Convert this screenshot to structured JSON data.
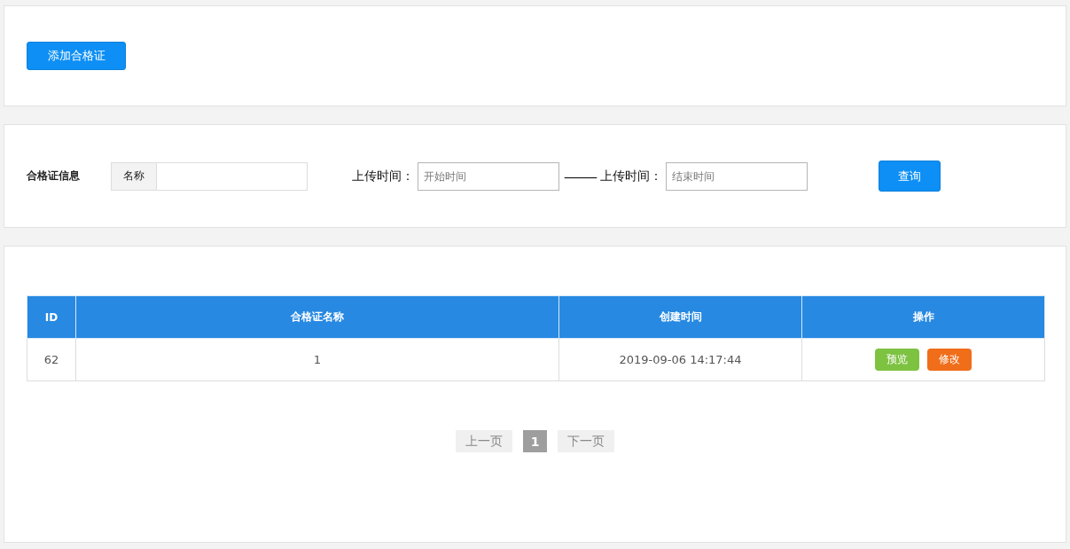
{
  "add_button": "添加合格证",
  "filter": {
    "title": "合格证信息",
    "name_addon": "名称",
    "start_label": "上传时间：",
    "start_placeholder": "开始时间",
    "separator": "———",
    "end_label": "上传时间：",
    "end_placeholder": "结束时间",
    "query_button": "查询"
  },
  "table": {
    "columns": [
      "ID",
      "合格证名称",
      "创建时间",
      "操作"
    ],
    "rows": [
      {
        "id": "62",
        "name": "1",
        "created": "2019-09-06 14:17:44",
        "actions": [
          {
            "kind": "preview",
            "label": "预览"
          },
          {
            "kind": "edit",
            "label": "修改"
          }
        ]
      }
    ]
  },
  "pagination": [
    {
      "kind": "prev",
      "label": "上一页",
      "disabled": true,
      "selected": false
    },
    {
      "kind": "page",
      "label": "1",
      "disabled": false,
      "selected": true
    },
    {
      "kind": "next",
      "label": "下一页",
      "disabled": true,
      "selected": false
    }
  ]
}
